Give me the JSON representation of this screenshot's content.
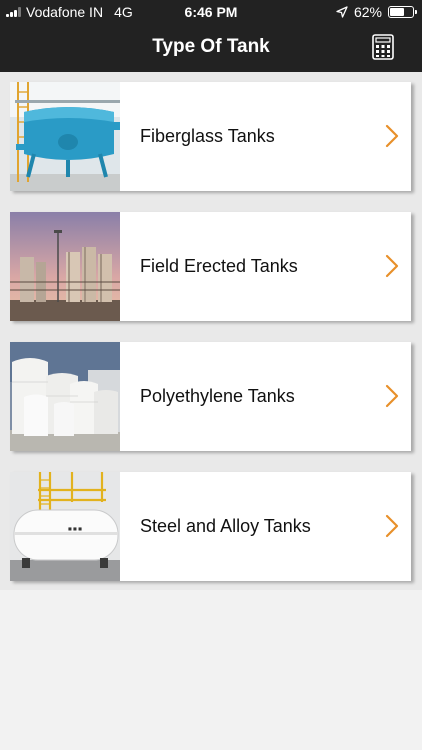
{
  "status_bar": {
    "carrier": "Vodafone IN",
    "network": "4G",
    "time": "6:46 PM",
    "battery": "62%",
    "battery_level": 0.62
  },
  "header": {
    "title": "Type Of Tank",
    "action_icon": "calculator-icon"
  },
  "colors": {
    "header_bg": "#222222",
    "accent": "#e8902a",
    "list_bg": "#e9e9e9"
  },
  "tank_types": [
    {
      "label": "Fiberglass Tanks",
      "icon": "chevron-right-icon"
    },
    {
      "label": "Field Erected Tanks",
      "icon": "chevron-right-icon"
    },
    {
      "label": "Polyethylene Tanks",
      "icon": "chevron-right-icon"
    },
    {
      "label": "Steel and Alloy Tanks",
      "icon": "chevron-right-icon"
    }
  ]
}
